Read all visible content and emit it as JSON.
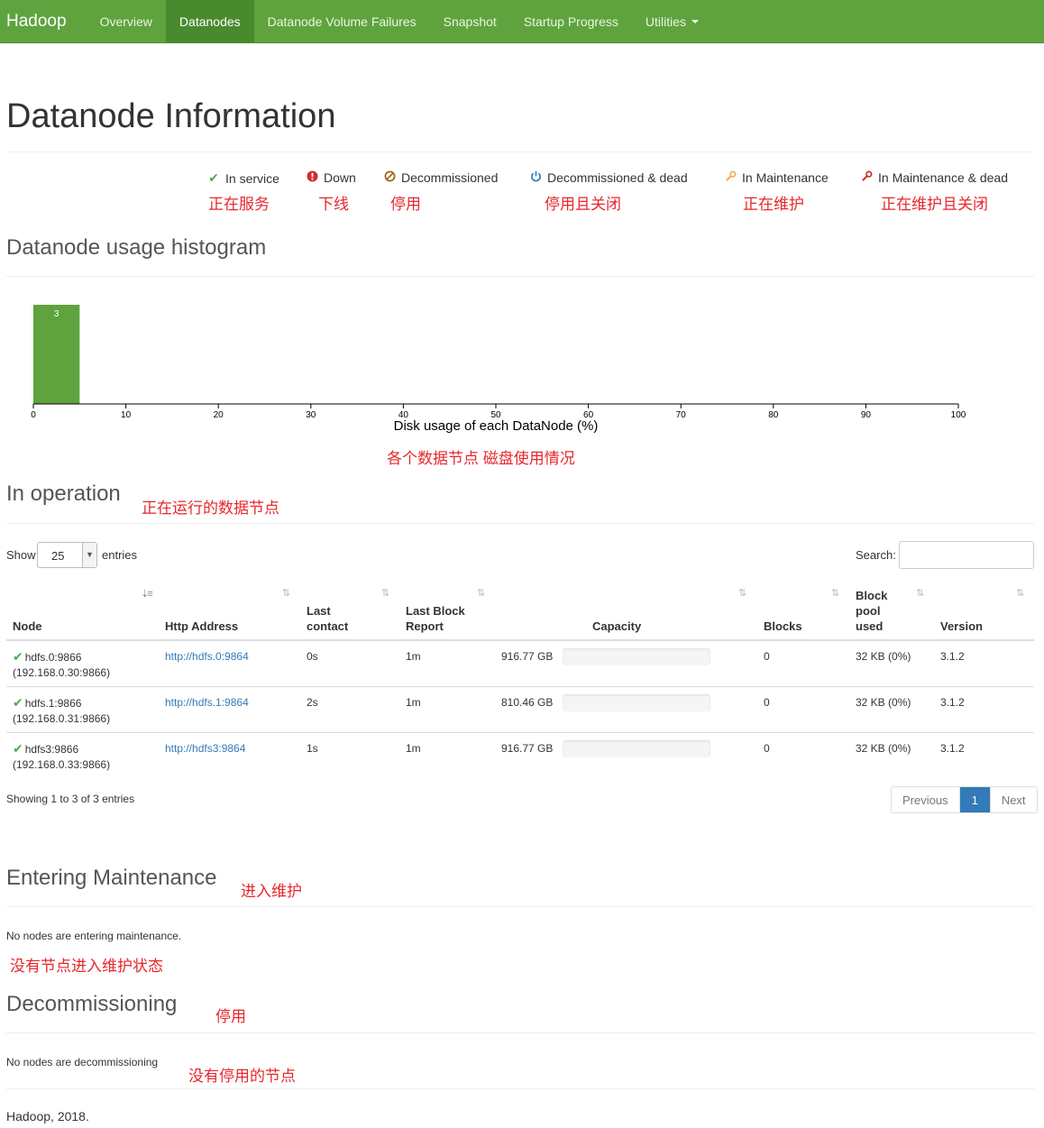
{
  "nav": {
    "brand": "Hadoop",
    "items": [
      "Overview",
      "Datanodes",
      "Datanode Volume Failures",
      "Snapshot",
      "Startup Progress",
      "Utilities"
    ],
    "active_index": 1
  },
  "page_title": "Datanode Information",
  "legend": [
    {
      "label": "In service",
      "icon": "check-icon",
      "color": "#4cae4c",
      "annotation": "正在服务"
    },
    {
      "label": "Down",
      "icon": "exclamation-circle-icon",
      "color": "#c9302c",
      "annotation": "下线"
    },
    {
      "label": "Decommissioned",
      "icon": "ban-icon",
      "color": "#a0621a",
      "annotation": "停用"
    },
    {
      "label": "Decommissioned & dead",
      "icon": "power-icon",
      "color": "#337ab7",
      "annotation": "停用且关闭"
    },
    {
      "label": "In Maintenance",
      "icon": "wrench-icon",
      "color": "#f0ad4e",
      "annotation": "正在维护"
    },
    {
      "label": "In Maintenance & dead",
      "icon": "wrench-icon",
      "color": "#c9302c",
      "annotation": "正在维护且关闭"
    }
  ],
  "histogram": {
    "heading": "Datanode usage histogram",
    "annotation": "各个数据节点 磁盘使用情况"
  },
  "chart_data": {
    "type": "bar",
    "title": "",
    "xlabel": "Disk usage of each DataNode (%)",
    "ylabel": "",
    "xlim": [
      0,
      100
    ],
    "x_ticks": [
      0,
      10,
      20,
      30,
      40,
      50,
      60,
      70,
      80,
      90,
      100
    ],
    "bins": [
      {
        "x0": 0,
        "x1": 5,
        "count": 3
      }
    ],
    "bar_color": "#5fa33e"
  },
  "in_operation": {
    "heading": "In operation",
    "annotation": "正在运行的数据节点",
    "show_label": "Show",
    "entries_label": "entries",
    "page_size": "25",
    "search_label": "Search:",
    "search_value": "",
    "columns": [
      {
        "l1": "",
        "l2": "",
        "l3": "Node"
      },
      {
        "l1": "",
        "l2": "",
        "l3": "Http Address"
      },
      {
        "l1": "",
        "l2": "Last",
        "l3": "contact"
      },
      {
        "l1": "",
        "l2": "Last Block",
        "l3": "Report"
      },
      {
        "l1": "",
        "l2": "",
        "l3": "Capacity"
      },
      {
        "l1": "",
        "l2": "",
        "l3": "Blocks"
      },
      {
        "l1": "Block",
        "l2": "pool",
        "l3": "used"
      },
      {
        "l1": "",
        "l2": "",
        "l3": "Version"
      }
    ],
    "rows": [
      {
        "node": "hdfs.0:9866",
        "ip": "(192.168.0.30:9866)",
        "http": "http://hdfs.0:9864",
        "last_contact": "0s",
        "last_block": "1m",
        "capacity": "916.77 GB",
        "blocks": "0",
        "pool_used": "32 KB (0%)",
        "version": "3.1.2"
      },
      {
        "node": "hdfs.1:9866",
        "ip": "(192.168.0.31:9866)",
        "http": "http://hdfs.1:9864",
        "last_contact": "2s",
        "last_block": "1m",
        "capacity": "810.46 GB",
        "blocks": "0",
        "pool_used": "32 KB (0%)",
        "version": "3.1.2"
      },
      {
        "node": "hdfs3:9866",
        "ip": "(192.168.0.33:9866)",
        "http": "http://hdfs3:9864",
        "last_contact": "1s",
        "last_block": "1m",
        "capacity": "916.77 GB",
        "blocks": "0",
        "pool_used": "32 KB (0%)",
        "version": "3.1.2"
      }
    ],
    "showing": "Showing 1 to 3 of 3 entries",
    "pager": {
      "previous": "Previous",
      "current": "1",
      "next": "Next"
    }
  },
  "entering_maintenance": {
    "heading": "Entering Maintenance",
    "annotation": "进入维护",
    "message": "No nodes are entering maintenance.",
    "message_annotation": "没有节点进入维护状态"
  },
  "decommissioning": {
    "heading": "Decommissioning",
    "annotation": "停用",
    "message": "No nodes are decommissioning",
    "message_annotation": "没有停用的节点"
  },
  "footer": "Hadoop, 2018."
}
